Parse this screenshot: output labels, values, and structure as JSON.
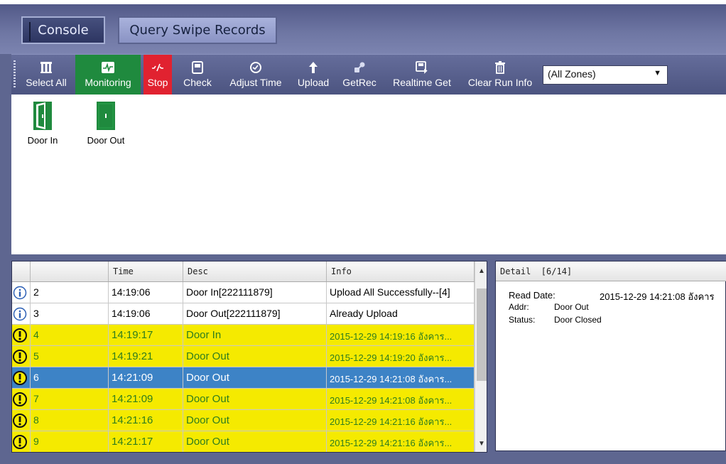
{
  "tabs": {
    "console": "Console",
    "query": "Query Swipe Records"
  },
  "toolbar": {
    "select_all": "Select All",
    "monitoring": "Monitoring",
    "stop": "Stop",
    "check": "Check",
    "adjust_time": "Adjust Time",
    "upload": "Upload",
    "getrec": "GetRec",
    "realtime_get": "Realtime Get",
    "clear_run_info": "Clear Run Info",
    "zone_selected": "(All Zones)"
  },
  "doors": [
    {
      "label": "Door In"
    },
    {
      "label": "Door Out"
    }
  ],
  "grid": {
    "headers": {
      "time": "Time",
      "desc": "Desc",
      "info": "Info"
    },
    "rows": [
      {
        "icon": "info-icon",
        "num": "2",
        "time": "14:19:06",
        "desc": "Door In[222111879]",
        "info": "Upload All Successfully--[4]",
        "style": "normal"
      },
      {
        "icon": "info-icon",
        "num": "3",
        "time": "14:19:06",
        "desc": "Door Out[222111879]",
        "info": "Already Upload",
        "style": "normal"
      },
      {
        "icon": "warning-icon",
        "num": "4",
        "time": "14:19:17",
        "desc": "Door In",
        "info": "2015-12-29 14:19:16 อังคาร...",
        "style": "warn"
      },
      {
        "icon": "warning-icon",
        "num": "5",
        "time": "14:19:21",
        "desc": "Door Out",
        "info": "2015-12-29 14:19:20 อังคาร...",
        "style": "warn"
      },
      {
        "icon": "warning-icon",
        "num": "6",
        "time": "14:21:09",
        "desc": "Door Out",
        "info": "2015-12-29 14:21:08 อังคาร...",
        "style": "selected"
      },
      {
        "icon": "warning-icon",
        "num": "7",
        "time": "14:21:09",
        "desc": "Door Out",
        "info": "2015-12-29 14:21:08 อังคาร...",
        "style": "warn"
      },
      {
        "icon": "warning-icon",
        "num": "8",
        "time": "14:21:16",
        "desc": "Door Out",
        "info": "2015-12-29 14:21:16 อังคาร...",
        "style": "warn"
      },
      {
        "icon": "warning-icon",
        "num": "9",
        "time": "14:21:17",
        "desc": "Door Out",
        "info": "2015-12-29 14:21:16 อังคาร...",
        "style": "warn"
      }
    ]
  },
  "detail": {
    "title": "Detail  [6/14]",
    "read_date_label": "Read Date:",
    "read_date_value": "2015-12-29 14:21:08 อังคาร",
    "addr_label": "Addr:",
    "addr_value": "Door Out",
    "status_label": "Status:",
    "status_value": "Door Closed"
  },
  "colors": {
    "warn_bg": "#f5ea00",
    "warn_text": "#2e7d1f",
    "selected_bg": "#3d83c6",
    "monitor_green": "#1f8a3e",
    "stop_red": "#e12230",
    "door_green": "#1f8a3e"
  }
}
